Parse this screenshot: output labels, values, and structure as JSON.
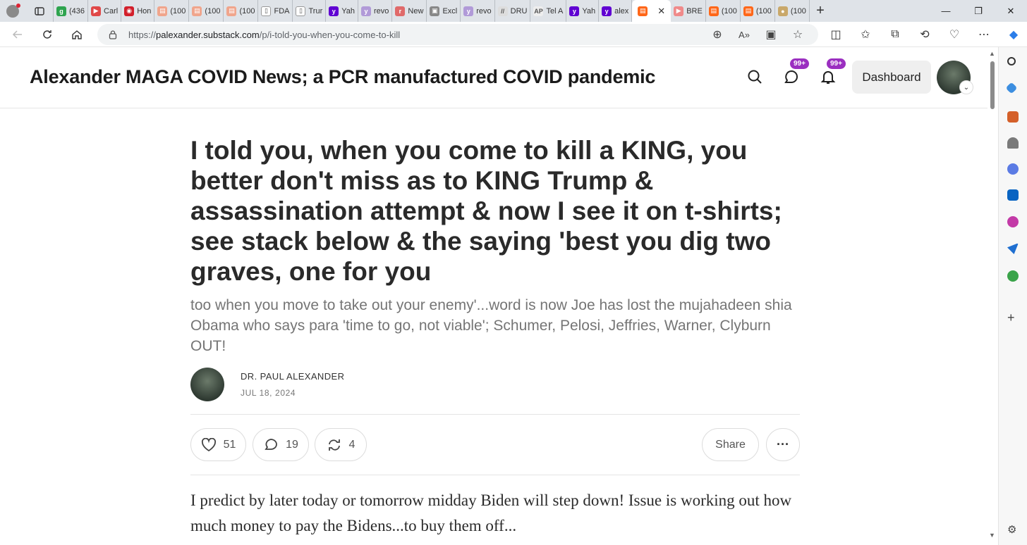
{
  "browser": {
    "tabs": [
      {
        "label": "(436",
        "fav": "#2ea44f",
        "glyph": "g"
      },
      {
        "label": "Carl",
        "fav": "#e04848",
        "glyph": "▶"
      },
      {
        "label": "Hon",
        "fav": "#d21f2b",
        "glyph": "◉"
      },
      {
        "label": "(100",
        "fav": "#f0a58c",
        "glyph": "▤"
      },
      {
        "label": "(100",
        "fav": "#f0a58c",
        "glyph": "▤"
      },
      {
        "label": "(100",
        "fav": "#f0a58c",
        "glyph": "▤"
      },
      {
        "label": "FDA",
        "fav": "#ffffff",
        "glyph": "▯"
      },
      {
        "label": "Trur",
        "fav": "#ffffff",
        "glyph": "▯"
      },
      {
        "label": "Yah",
        "fav": "#6001d2",
        "glyph": "y"
      },
      {
        "label": "revo",
        "fav": "#b19ad8",
        "glyph": "y"
      },
      {
        "label": "New",
        "fav": "#e06a6a",
        "glyph": "r"
      },
      {
        "label": "Excl",
        "fav": "#888888",
        "glyph": "▣"
      },
      {
        "label": "revo",
        "fav": "#b19ad8",
        "glyph": "y"
      },
      {
        "label": "DRU",
        "fav": "#dddddd",
        "glyph": "//"
      },
      {
        "label": "Tel A",
        "fav": "#eeeeee",
        "glyph": "AP"
      },
      {
        "label": "Yah",
        "fav": "#6001d2",
        "glyph": "y"
      },
      {
        "label": "alex",
        "fav": "#6001d2",
        "glyph": "y"
      }
    ],
    "active_tab": {
      "label": "",
      "fav": "#ff6719",
      "close": "✕"
    },
    "tabs_after": [
      {
        "label": "BRE",
        "fav": "#f08a8a",
        "glyph": "▶"
      },
      {
        "label": "(100",
        "fav": "#ff6719",
        "glyph": "▤"
      },
      {
        "label": "(100",
        "fav": "#ff6719",
        "glyph": "▤"
      },
      {
        "label": "(100",
        "fav": "#c9a86a",
        "glyph": "●"
      }
    ],
    "url_scheme": "https://",
    "url_host": "palexander.substack.com",
    "url_path": "/p/i-told-you-when-you-come-to-kill"
  },
  "header": {
    "publication_title": "Alexander MAGA COVID News; a PCR manufactured COVID pandemic",
    "chat_badge": "99+",
    "notif_badge": "99+",
    "dashboard_label": "Dashboard"
  },
  "post": {
    "title": "I told you, when you come to kill a KING, you better don't miss as to KING Trump & assassination attempt & now I see it on t-shirts; see stack below & the saying 'best you dig two graves, one for you",
    "subtitle": "too when you move to take out your enemy'...word is now Joe has lost the mujahadeen shia Obama who says para 'time to go, not viable'; Schumer, Pelosi, Jeffries, Warner, Clyburn OUT!",
    "author": "DR. PAUL ALEXANDER",
    "date": "JUL 18, 2024",
    "likes": "51",
    "comments": "19",
    "restacks": "4",
    "share_label": "Share",
    "body": "I predict by later today or tomorrow midday Biden will step down! Issue is working out how much money to pay the Bidens...to buy them off..."
  }
}
